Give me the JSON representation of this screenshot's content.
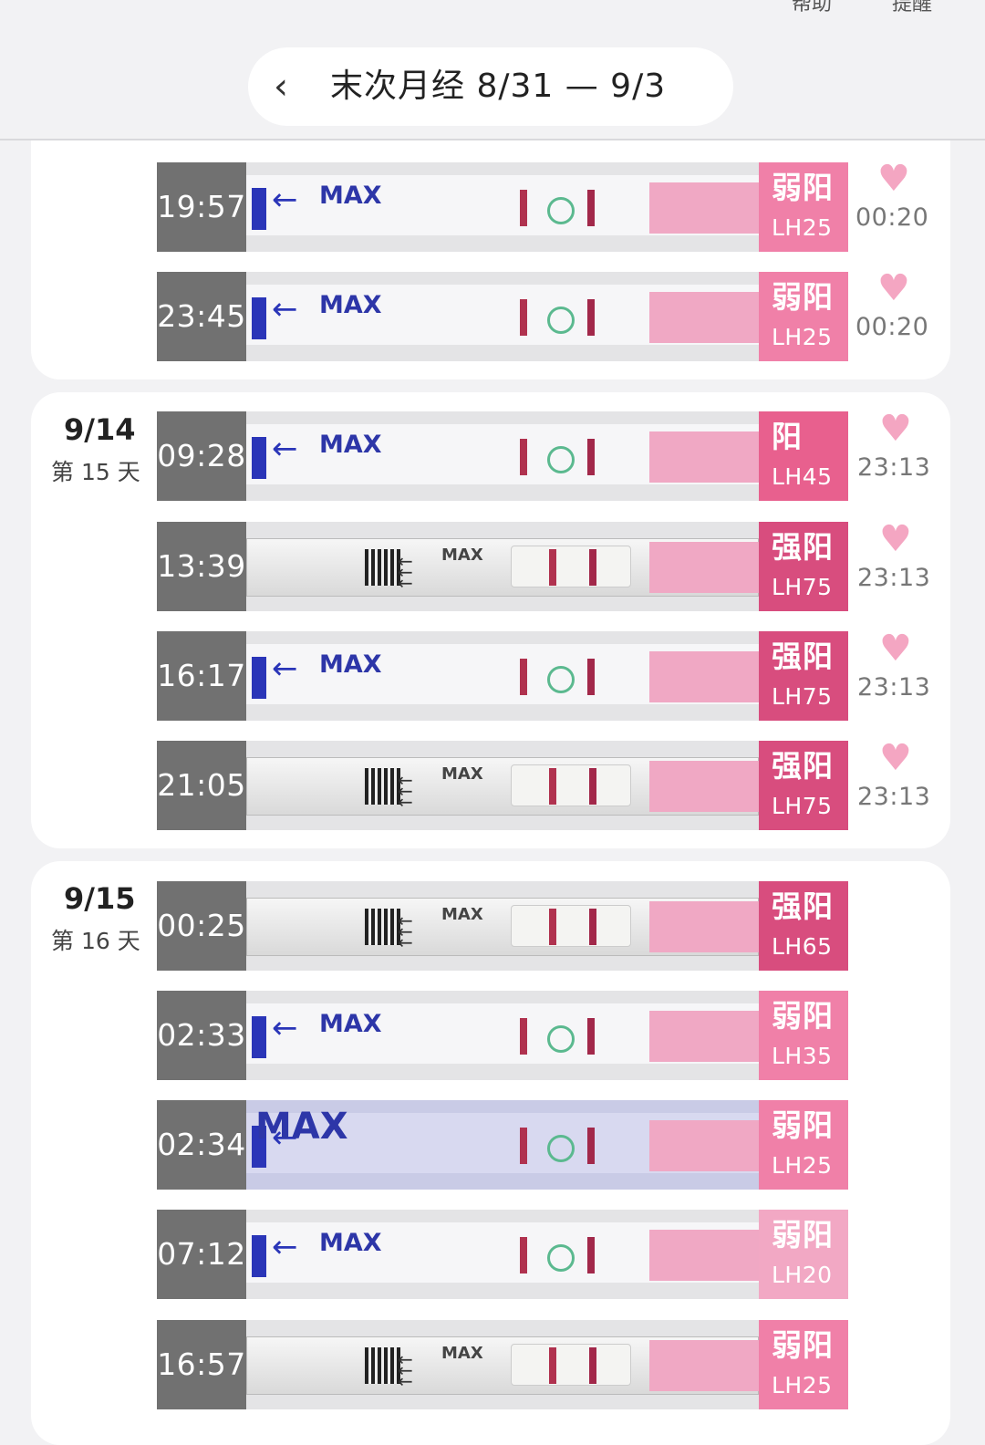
{
  "header": {
    "help_label": "帮助",
    "remind_label": "提醒",
    "back_icon": "chevron-left-icon",
    "title": "末次月经 8/31 — 9/3"
  },
  "colors": {
    "weak_positive": "#f080a8",
    "positive": "#e8608e",
    "strong_positive": "#d84d7e",
    "faint_badge": "#f2a8c4",
    "heart": "#f4a6c2"
  },
  "days": [
    {
      "date": "",
      "day_label": "",
      "rows": [
        {
          "time": "19:57",
          "result": "弱阳",
          "lh": "LH25",
          "heart_time": "00:20"
        },
        {
          "time": "23:45",
          "result": "弱阳",
          "lh": "LH25",
          "heart_time": "00:20"
        }
      ]
    },
    {
      "date": "9/14",
      "day_label": "第 15 天",
      "rows": [
        {
          "time": "09:28",
          "result": "阳",
          "lh": "LH45",
          "heart_time": "23:13"
        },
        {
          "time": "13:39",
          "result": "强阳",
          "lh": "LH75",
          "heart_time": "23:13"
        },
        {
          "time": "16:17",
          "result": "强阳",
          "lh": "LH75",
          "heart_time": "23:13"
        },
        {
          "time": "21:05",
          "result": "强阳",
          "lh": "LH75",
          "heart_time": "23:13"
        }
      ]
    },
    {
      "date": "9/15",
      "day_label": "第 16 天",
      "rows": [
        {
          "time": "00:25",
          "result": "强阳",
          "lh": "LH65",
          "heart_time": ""
        },
        {
          "time": "02:33",
          "result": "弱阳",
          "lh": "LH35",
          "heart_time": ""
        },
        {
          "time": "02:34",
          "result": "弱阳",
          "lh": "LH25",
          "heart_time": ""
        },
        {
          "time": "07:12",
          "result": "弱阳",
          "lh": "LH20",
          "heart_time": ""
        },
        {
          "time": "16:57",
          "result": "弱阳",
          "lh": "LH25",
          "heart_time": ""
        }
      ]
    }
  ],
  "strip_text": {
    "max": "MAX",
    "arrow": "←"
  }
}
